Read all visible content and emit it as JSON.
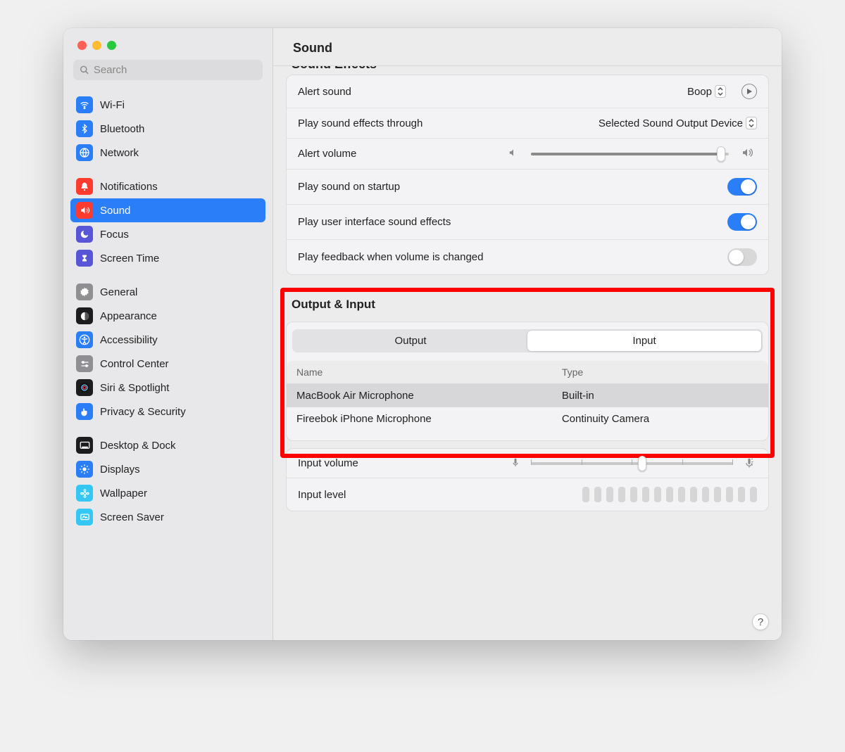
{
  "window": {
    "title": "Sound"
  },
  "search": {
    "placeholder": "Search"
  },
  "sidebar": {
    "groups": [
      {
        "items": [
          {
            "label": "Wi-Fi",
            "icon": "wifi",
            "bg": "#2a7ef7"
          },
          {
            "label": "Bluetooth",
            "icon": "bluetooth",
            "bg": "#2a7ef7"
          },
          {
            "label": "Network",
            "icon": "globe",
            "bg": "#2a7ef7"
          }
        ]
      },
      {
        "items": [
          {
            "label": "Notifications",
            "icon": "bell",
            "bg": "#ff3b30"
          },
          {
            "label": "Sound",
            "icon": "speaker",
            "bg": "#ff3b30",
            "selected": true
          },
          {
            "label": "Focus",
            "icon": "moon",
            "bg": "#5856d6"
          },
          {
            "label": "Screen Time",
            "icon": "hourglass",
            "bg": "#5856d6"
          }
        ]
      },
      {
        "items": [
          {
            "label": "General",
            "icon": "gear",
            "bg": "#8e8e93"
          },
          {
            "label": "Appearance",
            "icon": "appearance",
            "bg": "#1c1c1e"
          },
          {
            "label": "Accessibility",
            "icon": "accessibility",
            "bg": "#2a7ef7"
          },
          {
            "label": "Control Center",
            "icon": "control",
            "bg": "#8e8e93"
          },
          {
            "label": "Siri & Spotlight",
            "icon": "siri",
            "bg": "#1c1c1e"
          },
          {
            "label": "Privacy & Security",
            "icon": "hand",
            "bg": "#2a7ef7"
          }
        ]
      },
      {
        "items": [
          {
            "label": "Desktop & Dock",
            "icon": "dock",
            "bg": "#1c1c1e"
          },
          {
            "label": "Displays",
            "icon": "sun",
            "bg": "#2a7ef7"
          },
          {
            "label": "Wallpaper",
            "icon": "wallpaper",
            "bg": "#34c7f3"
          },
          {
            "label": "Screen Saver",
            "icon": "screensaver",
            "bg": "#34c7f3"
          }
        ]
      }
    ]
  },
  "soundEffects": {
    "section_title": "Sound Effects",
    "alert_sound_label": "Alert sound",
    "alert_sound_value": "Boop",
    "play_through_label": "Play sound effects through",
    "play_through_value": "Selected Sound Output Device",
    "alert_volume_label": "Alert volume",
    "alert_volume_pct": 96,
    "startup_label": "Play sound on startup",
    "startup_on": true,
    "ui_sounds_label": "Play user interface sound effects",
    "ui_sounds_on": true,
    "feedback_label": "Play feedback when volume is changed",
    "feedback_on": false
  },
  "outputInput": {
    "section_title": "Output & Input",
    "tabs": [
      "Output",
      "Input"
    ],
    "active_tab": 1,
    "columns": [
      "Name",
      "Type"
    ],
    "rows": [
      {
        "name": "MacBook Air Microphone",
        "type": "Built-in",
        "selected": true
      },
      {
        "name": "Fireebok iPhone Microphone",
        "type": "Continuity Camera",
        "selected": false
      }
    ],
    "input_volume_label": "Input volume",
    "input_volume_pct": 55,
    "input_level_label": "Input level",
    "level_segments": 15
  },
  "help_label": "?"
}
